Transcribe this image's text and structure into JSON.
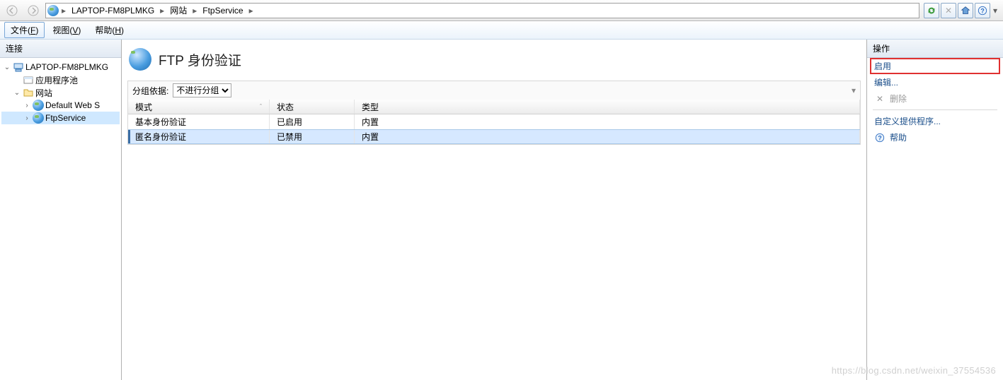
{
  "nav": {
    "crumbs": [
      "LAPTOP-FM8PLMKG",
      "网站",
      "FtpService"
    ],
    "sep": "▸"
  },
  "menu": {
    "file": "文件(",
    "file_u": "F",
    "file2": ")",
    "view": "视图(",
    "view_u": "V",
    "view2": ")",
    "help": "帮助(",
    "help_u": "H",
    "help2": ")"
  },
  "left": {
    "header": "连接",
    "root": "LAPTOP-FM8PLMKG",
    "app_pool": "应用程序池",
    "sites": "网站",
    "default_site": "Default Web S",
    "ftp": "FtpService"
  },
  "main": {
    "title": "FTP 身份验证",
    "group_label": "分组依据:",
    "group_value": "不进行分组",
    "cols": [
      "模式",
      "状态",
      "类型"
    ],
    "rows": [
      {
        "mode": "基本身份验证",
        "state": "已启用",
        "type": "内置"
      },
      {
        "mode": "匿名身份验证",
        "state": "已禁用",
        "type": "内置"
      }
    ]
  },
  "actions": {
    "header": "操作",
    "enable": "启用",
    "edit": "编辑...",
    "delete": "删除",
    "custom": "自定义提供程序...",
    "help": "帮助"
  },
  "watermark": "https://blog.csdn.net/weixin_37554536"
}
